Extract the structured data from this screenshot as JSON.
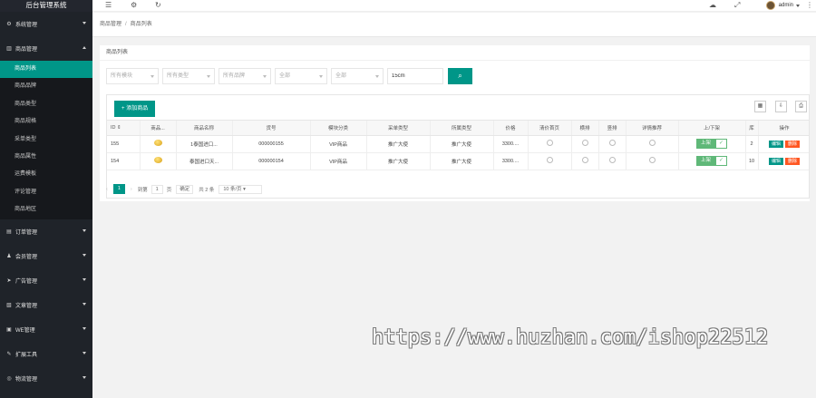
{
  "sidebar": {
    "title": "后台管理系统",
    "groups": [
      {
        "icon": "gear-icon",
        "label": "系统管理"
      },
      {
        "icon": "bar-chart-icon",
        "label": "商品管理",
        "expanded": true
      },
      {
        "icon": "clipboard-icon",
        "label": "订单管理"
      },
      {
        "icon": "users-icon",
        "label": "会员管理"
      },
      {
        "icon": "megaphone-icon",
        "label": "广告管理"
      },
      {
        "icon": "document-icon",
        "label": "文章管理"
      },
      {
        "icon": "chat-icon",
        "label": "WE管理"
      },
      {
        "icon": "wrench-icon",
        "label": "扩展工具"
      },
      {
        "icon": "location-icon",
        "label": "物流管理"
      }
    ],
    "sub_items": [
      "商品列表",
      "商品品牌",
      "商品类型",
      "商品规格",
      "采单类型",
      "商品属性",
      "运费模板",
      "评论管理",
      "商品地区"
    ],
    "active_sub": "商品列表"
  },
  "topbar": {
    "user": "admin",
    "icons": [
      "menu-icon",
      "settings-icon",
      "refresh-icon",
      "theme-icon",
      "fullscreen-icon",
      "more-icon"
    ]
  },
  "breadcrumb": {
    "root": "商品管理",
    "sep": "/",
    "current": "商品列表"
  },
  "card": {
    "title": "商品列表"
  },
  "filters": {
    "selects": [
      "所有模块",
      "所有类型",
      "所有品牌",
      "全部",
      "全部"
    ],
    "keyword_value": "15cm",
    "search_icon": "search-icon"
  },
  "toolbar": {
    "add_label": "添加商品",
    "add_icon": "+"
  },
  "table": {
    "headers": [
      "ID ⇕",
      "商品...",
      "商品名称",
      "货号",
      "模块分类",
      "采单类型",
      "所属类型",
      "价格",
      "清价首页",
      "横排",
      "竖排",
      "详情推荐",
      "上/下架",
      "库",
      "操作"
    ],
    "rows": [
      {
        "id": "155",
        "name": "1泰国进口...",
        "sku": "000000155",
        "module": "VIP商品",
        "order_type": "推广大使",
        "type": "推广大使",
        "price": "3300....",
        "stock": "2"
      },
      {
        "id": "154",
        "name": "泰国进口天...",
        "sku": "000000154",
        "module": "VIP商品",
        "order_type": "推广大使",
        "type": "推广大使",
        "price": "3300....",
        "stock": "10"
      }
    ],
    "switch_label": "上架",
    "edit_label": "编辑",
    "delete_label": "删除"
  },
  "pager": {
    "current": "1",
    "goto_label": "到第",
    "page_value": "1",
    "page_unit": "页",
    "confirm": "确定",
    "total": "共 2 条",
    "page_size": "10 条/页"
  },
  "watermark": "https://www.huzhan.com/ishop22512"
}
